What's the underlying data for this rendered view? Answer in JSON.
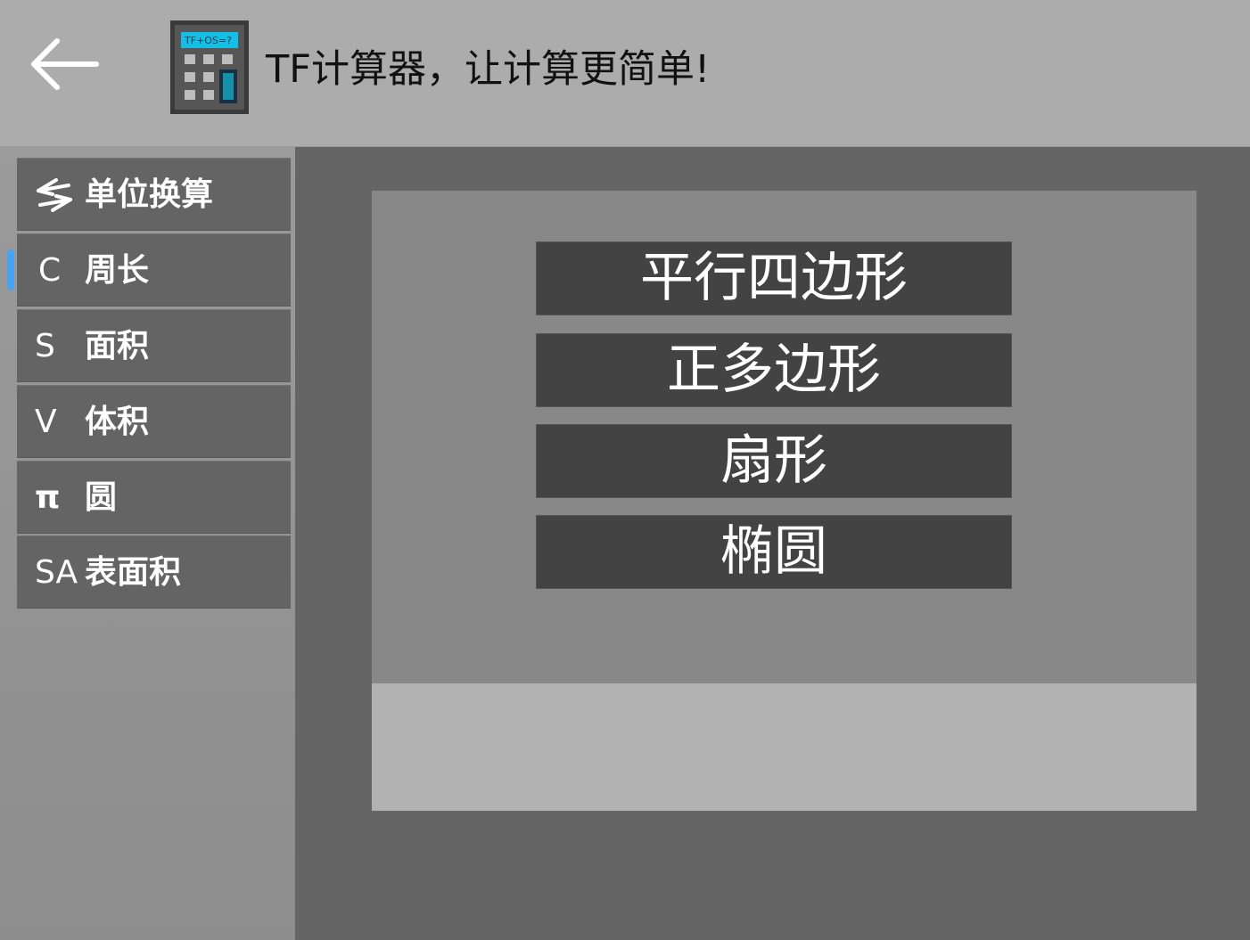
{
  "header": {
    "app_icon_screen_text": "TF+OS=?",
    "title": "TF计算器，让计算更简单!"
  },
  "sidebar": {
    "items": [
      {
        "symbol": "⇄",
        "label": "单位换算",
        "icon_name": "convert-arrows-icon"
      },
      {
        "symbol": "C",
        "label": "周长",
        "active": true
      },
      {
        "symbol": "S",
        "label": "面积"
      },
      {
        "symbol": "V",
        "label": "体积"
      },
      {
        "symbol": "π",
        "label": "圆"
      },
      {
        "symbol": "SA",
        "label": "表面积"
      }
    ]
  },
  "main": {
    "shapes": [
      "平行四边形",
      "正多边形",
      "扇形",
      "椭圆"
    ],
    "result": ""
  },
  "colors": {
    "header_bg": "#acacac",
    "sidebar_bg": "#939393",
    "nav_item_bg": "#646464",
    "content_bg": "#656565",
    "panel_bg": "#888888",
    "button_bg": "#434343",
    "result_bg": "#b2b2b2",
    "accent": "#4aa3f0"
  }
}
